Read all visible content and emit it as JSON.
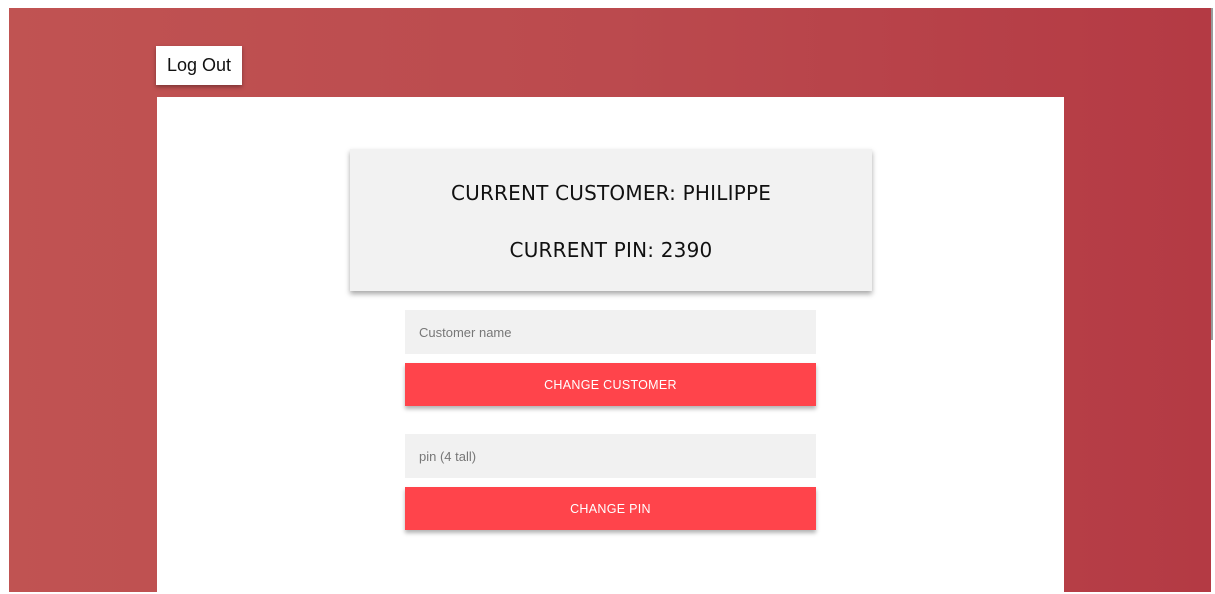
{
  "header": {
    "logout_label": "Log Out"
  },
  "info": {
    "customer_line": "CURRENT CUSTOMER: PHILIPPE",
    "pin_line": "CURRENT PIN: 2390"
  },
  "form": {
    "customer_placeholder": "Customer name",
    "change_customer_label": "CHANGE CUSTOMER",
    "pin_placeholder": "pin (4 tall)",
    "change_pin_label": "CHANGE PIN"
  },
  "colors": {
    "background_start": "#c05352",
    "background_end": "#b43a44",
    "button": "#ff444b",
    "input_background": "#f1f1f1",
    "info_background": "#f2f2f2"
  }
}
